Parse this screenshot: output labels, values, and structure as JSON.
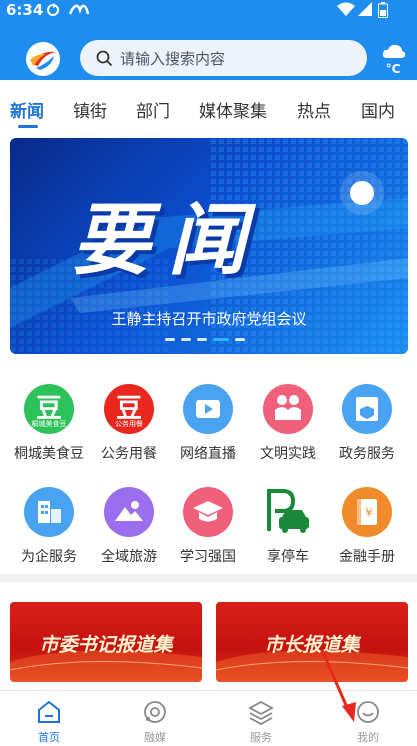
{
  "status_bar": {
    "time": "6:34"
  },
  "search": {
    "placeholder": "请输入搜索内容"
  },
  "weather": {
    "temperature": "°C"
  },
  "tabs": [
    {
      "label": "新闻",
      "active": true
    },
    {
      "label": "镇街"
    },
    {
      "label": "部门"
    },
    {
      "label": "媒体聚集"
    },
    {
      "label": "热点"
    },
    {
      "label": "国内"
    }
  ],
  "banner": {
    "headline": "要闻",
    "caption": "王静主持召开市政府党组会议",
    "active_slide": 4,
    "slide_count": 5
  },
  "services": [
    {
      "label": "桐城美食豆",
      "icon": "food-bean-icon",
      "icon_text": "豆",
      "sub_text": "桐城美食豆",
      "color": "#2ec25a"
    },
    {
      "label": "公务用餐",
      "icon": "dining-bean-icon",
      "icon_text": "豆",
      "sub_text": "公务用餐",
      "color": "#e8281e"
    },
    {
      "label": "网络直播",
      "icon": "live-video-icon",
      "color": "#4aa3f0"
    },
    {
      "label": "文明实践",
      "icon": "volunteer-icon",
      "color": "#f0607a"
    },
    {
      "label": "政务服务",
      "icon": "gov-service-icon",
      "color": "#4aa3f0"
    },
    {
      "label": "为企服务",
      "icon": "enterprise-building-icon",
      "color": "#4aa3f0"
    },
    {
      "label": "全域旅游",
      "icon": "tourism-mountain-icon",
      "color": "#9b6ef0"
    },
    {
      "label": "学习强国",
      "icon": "graduation-cap-icon",
      "color": "#f0607a"
    },
    {
      "label": "享停车",
      "icon": "parking-car-icon",
      "color": "#1a8a3a"
    },
    {
      "label": "金融手册",
      "icon": "finance-book-icon",
      "color": "#f08a2a"
    }
  ],
  "promo_cards": [
    {
      "title": "市委书记报道集"
    },
    {
      "title": "市长报道集"
    }
  ],
  "bottom_nav": [
    {
      "label": "首页",
      "icon": "home-icon",
      "active": true
    },
    {
      "label": "融媒",
      "icon": "media-orbit-icon"
    },
    {
      "label": "服务",
      "icon": "layers-icon"
    },
    {
      "label": "我的",
      "icon": "profile-icon"
    }
  ],
  "colors": {
    "brand": "#1f8cf0",
    "accent": "#1f73d6",
    "red": "#c4120e"
  }
}
